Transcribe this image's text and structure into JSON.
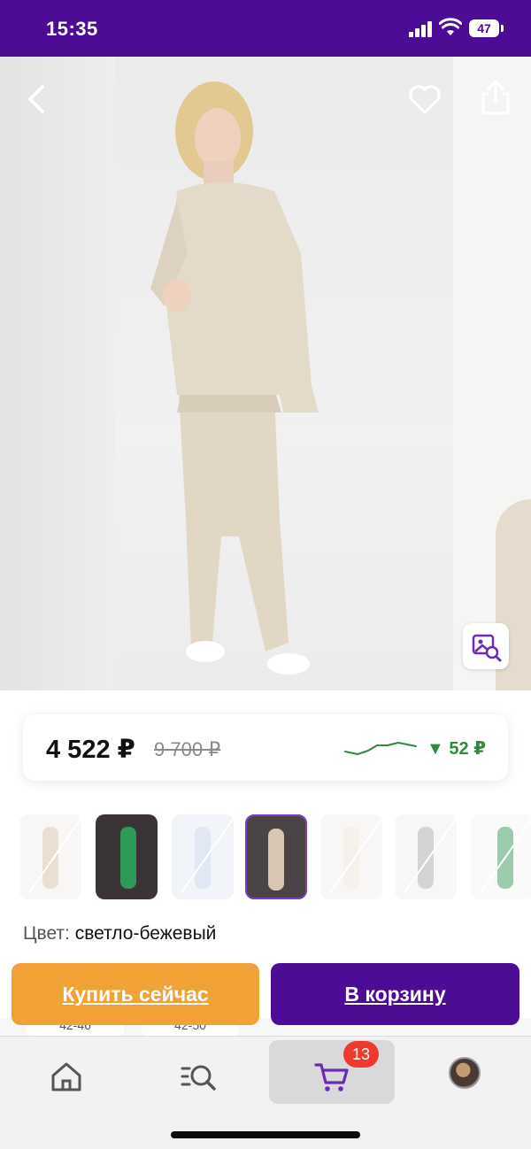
{
  "status_bar": {
    "time": "15:35",
    "battery": "47",
    "background": "#4d0c95"
  },
  "header_actions": {
    "back_icon": "chevron-left-icon",
    "favorite_icon": "heart-icon",
    "share_icon": "share-icon",
    "photo_search_icon": "image-search-icon"
  },
  "price": {
    "current": "4 522 ₽",
    "old": "9 700 ₽",
    "drop": "▼ 52 ₽",
    "drop_color": "#2d8a3e"
  },
  "gallery": {
    "thumb_count": 7,
    "selected_index": 3
  },
  "color": {
    "label": "Цвет:",
    "value": "светло-бежевый"
  },
  "actions": {
    "buy_now": "Купить сейчас",
    "add_to_cart": "В корзину",
    "buy_now_color": "#f1a236",
    "cart_color": "#4d0c95"
  },
  "sizes_partial": [
    "42-46",
    "42-50"
  ],
  "tabbar": {
    "items": [
      "home-icon",
      "catalog-search-icon",
      "cart-icon",
      "profile-avatar"
    ],
    "active_index": 2,
    "cart_badge": "13"
  }
}
